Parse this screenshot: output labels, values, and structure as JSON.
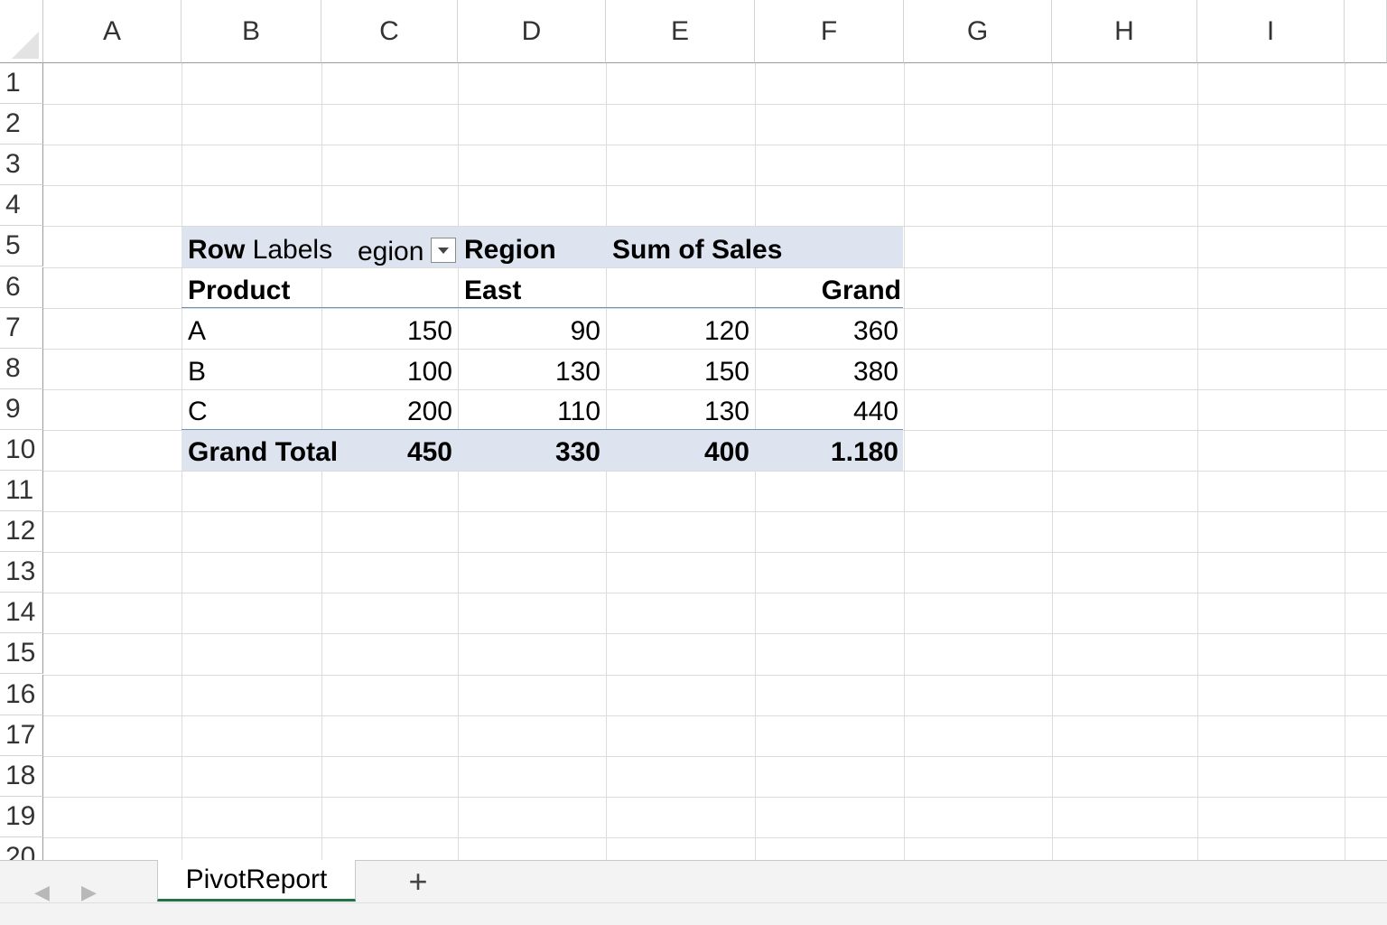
{
  "columns": [
    "A",
    "B",
    "C",
    "D",
    "E",
    "F",
    "G",
    "H",
    "I"
  ],
  "rows": [
    "1",
    "2",
    "3",
    "4",
    "5",
    "6",
    "7",
    "8",
    "9",
    "10",
    "11",
    "12",
    "13",
    "14",
    "15",
    "16",
    "17",
    "18",
    "19",
    "20"
  ],
  "pivot": {
    "row5": {
      "b": "Row Labels",
      "c": "egion",
      "d": "Region",
      "e": "Sum of Sales"
    },
    "row6": {
      "b": "Product",
      "d": "East",
      "f": "Grand"
    },
    "data_rows": [
      {
        "label": "A",
        "c": "150",
        "d": "90",
        "e": "120",
        "f": "360"
      },
      {
        "label": "B",
        "c": "100",
        "d": "130",
        "e": "150",
        "f": "380"
      },
      {
        "label": "C",
        "c": "200",
        "d": "110",
        "e": "130",
        "f": "440"
      }
    ],
    "grand_total": {
      "label": "Grand Total",
      "c": "450",
      "d": "330",
      "e": "400",
      "f": "1.180"
    },
    "header_band_color": "#dde4f0",
    "filter_icon": "dropdown-arrow-icon"
  },
  "tabs": {
    "sheets": [
      "PivotReport"
    ],
    "active": "PivotReport",
    "add_label": "+",
    "prev_icon": "scroll-left-icon",
    "next_icon": "scroll-right-icon",
    "accent_color": "#217346"
  }
}
